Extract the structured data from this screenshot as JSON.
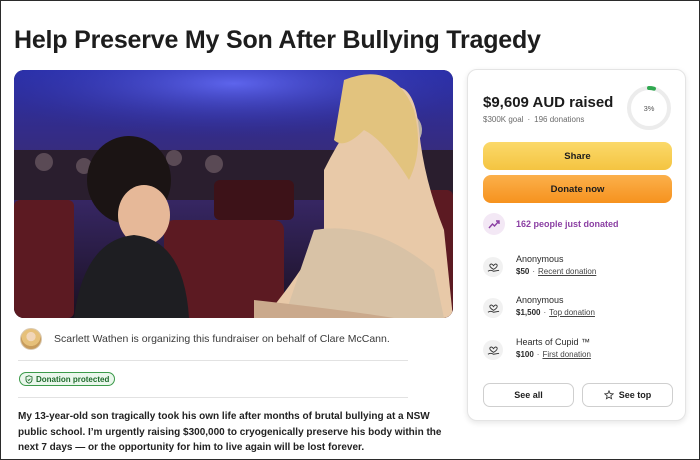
{
  "page": {
    "title": "Help Preserve My Son After Bullying Tragedy"
  },
  "hero": {
    "alt_description": "",
    "icon": "fundraiser-hero-photo"
  },
  "organizer": {
    "text": "Scarlett Wathen is organizing this fundraiser on behalf of Clare McCann."
  },
  "badge": {
    "label": "Donation protected",
    "color": "#3c9a4a"
  },
  "story": {
    "text": "My 13-year-old son tragically took his own life after months of brutal bullying at a NSW public school. I’m urgently raising $300,000 to cryogenically preserve his body within the next 7 days — or the opportunity for him to live again will be lost forever."
  },
  "summary": {
    "raised": "$9,609 AUD raised",
    "goal": "$300K goal",
    "donations": "196 donations",
    "progress_label": "3%",
    "progress_fraction": 0.03,
    "accent": "#2fa84f"
  },
  "actions": {
    "share_label": "Share",
    "donate_label": "Donate now",
    "share_color": "#f4c441",
    "donate_color": "#f6921e"
  },
  "activity": {
    "trend_text": "162 people just donated",
    "trend_color": "#8b3fa3"
  },
  "donations_list": [
    {
      "name": "Anonymous",
      "amount": "$50",
      "tag": "Recent donation"
    },
    {
      "name": "Anonymous",
      "amount": "$1,500",
      "tag": "Top donation"
    },
    {
      "name": "Hearts of Cupid ™",
      "amount": "$100",
      "tag": "First donation"
    }
  ],
  "footer_buttons": {
    "see_all": "See all",
    "see_top": "See top"
  }
}
